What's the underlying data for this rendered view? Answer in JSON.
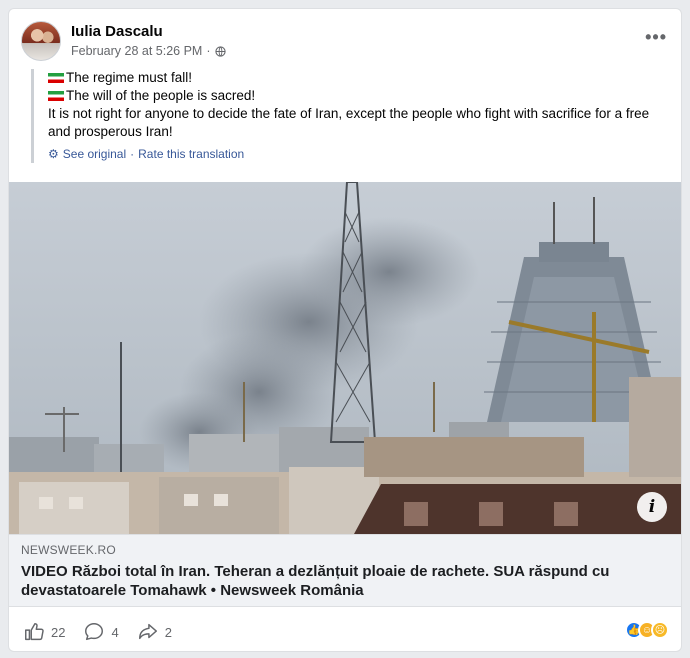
{
  "post": {
    "author": "Iulia Dascalu",
    "timestamp": "February 28 at 5:26 PM",
    "separator": " · ",
    "lines": [
      "The regime must fall!",
      "The will of the people is sacred!",
      "It is not right for anyone to decide the fate of Iran, except the people who fight with sacrifice for a free and prosperous Iran!"
    ],
    "see_original": "See original",
    "rate_translation": "Rate this translation",
    "translate_separator": " · "
  },
  "link": {
    "domain": "NEWSWEEK.RO",
    "headline": "VIDEO Război total în Iran. Teheran a dezlănțuit ploaie de rachete. SUA răspund cu devastatoarele Tomahawk • Newsweek România"
  },
  "stats": {
    "likes": "22",
    "comments": "4",
    "shares": "2"
  },
  "icons": {
    "more": "more-options-icon",
    "globe": "globe-icon",
    "flag": "iran-flag-icon",
    "like": "like-icon",
    "comment": "comment-icon",
    "share": "share-icon",
    "info": "info-icon"
  },
  "colors": {
    "link": "#385898",
    "muted": "#65676b",
    "like_blue": "#1877f2"
  }
}
